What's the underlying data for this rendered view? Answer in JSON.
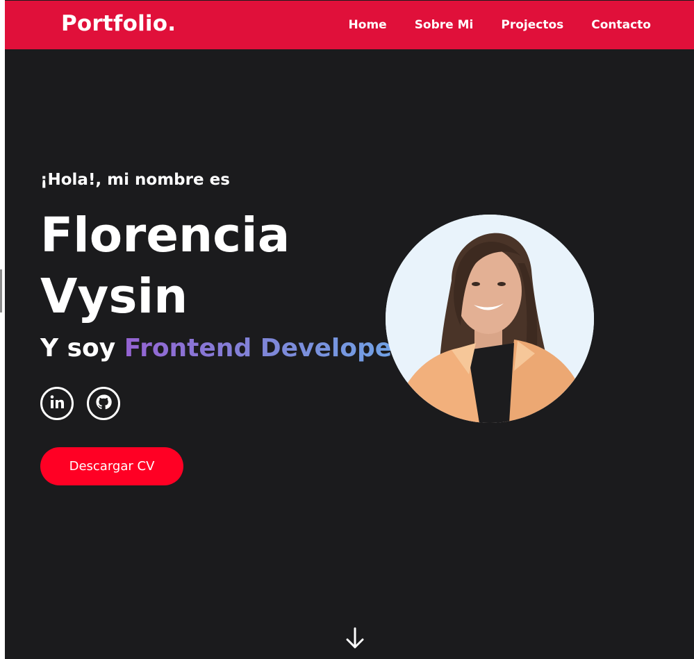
{
  "header": {
    "logo": "Portfolio.",
    "nav": [
      "Home",
      "Sobre Mi",
      "Projectos",
      "Contacto"
    ]
  },
  "hero": {
    "greeting": "¡Hola!, mi nombre es",
    "name_line1": "Florencia",
    "name_line2": "Vysin",
    "role_prefix": "Y soy",
    "role_highlight": "Frontend Developer",
    "cv_button": "Descargar CV"
  },
  "socials": [
    "linkedin-icon",
    "github-icon"
  ],
  "colors": {
    "navbar": "#e0103a",
    "background": "#1b1b1d",
    "button": "#ff0024",
    "gradient_start": "#9563d2",
    "gradient_end": "#6fa4e6"
  }
}
